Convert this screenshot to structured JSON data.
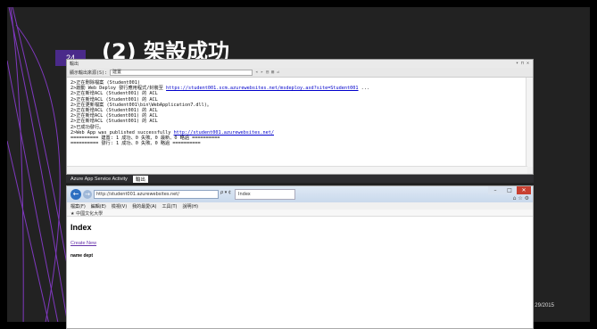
{
  "slide": {
    "number": "24",
    "title": "(2) 架設成功",
    "date": "29/2015"
  },
  "vs_window": {
    "title": "輸出",
    "controls": "▾ ⊓ ✕",
    "source_label": "顯示輸出來源(S):",
    "source_value": "建置",
    "lines": [
      {
        "text": "2>正在刪除檔案 (Student001)",
        "link": ""
      },
      {
        "text": "2>啟動 Web Deploy 發行應用程式/封裝至 ",
        "link": "https://student001.scm.azurewebsites.net/msdeploy.axd?site=Student001",
        "suffix": " ..."
      },
      {
        "text": "2>正在新增ACL (Student001) 的 ACL",
        "link": ""
      },
      {
        "text": "2>正在新增ACL (Student001) 的 ACL",
        "link": ""
      },
      {
        "text": "2>正在更新檔案 (Student001\\bin\\WebApplication7.dll)。",
        "link": ""
      },
      {
        "text": "2>正在新增ACL (Student001) 的 ACL",
        "link": ""
      },
      {
        "text": "2>正在新增ACL (Student001) 的 ACL",
        "link": ""
      },
      {
        "text": "2>正在新增ACL (Student001) 的 ACL",
        "link": ""
      },
      {
        "text": "2>已成功發行。",
        "link": ""
      },
      {
        "text": "2>Web App was published successfully ",
        "link": "http://student001.azurewebsites.net/",
        "suffix": ""
      },
      {
        "text": "========== 建置: 1 成功、0 失敗、0 最新、0 略過 ==========",
        "link": ""
      },
      {
        "text": "========== 發行: 1 成功、0 失敗、0 略過 ==========",
        "link": ""
      }
    ],
    "tabs": [
      "Azure App Service Activity",
      "輸出"
    ]
  },
  "browser": {
    "address": "http://student001.azurewebsites.net/",
    "address_controls": "ρ ▾ ¢",
    "tab_label": "Index",
    "menu": [
      "檔案(F)",
      "編輯(E)",
      "檢視(V)",
      "我的最愛(A)",
      "工具(T)",
      "說明(H)"
    ],
    "favorites": "中國文化大學",
    "page_heading": "Index",
    "create_link": "Create New",
    "columns": "name dept"
  }
}
